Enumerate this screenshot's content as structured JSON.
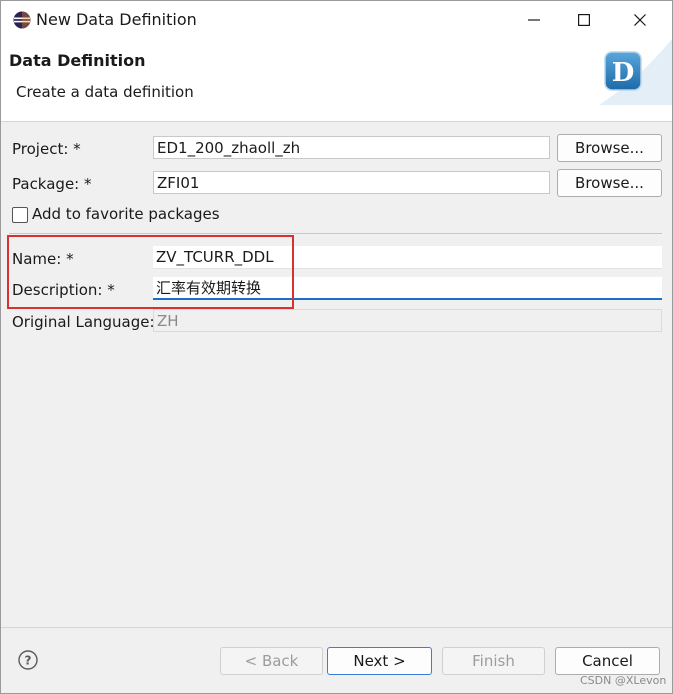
{
  "window": {
    "title": "New Data Definition"
  },
  "banner": {
    "title": "Data Definition",
    "subtitle": "Create a data definition",
    "icon_letter": "D"
  },
  "form": {
    "project": {
      "label": "Project: *",
      "value": "ED1_200_zhaoll_zh",
      "browse_label": "Browse..."
    },
    "package": {
      "label": "Package: *",
      "value": "ZFI01",
      "browse_label": "Browse..."
    },
    "favorite": {
      "label": "Add to favorite packages",
      "checked": false
    },
    "name": {
      "label": "Name: *",
      "value": "ZV_TCURR_DDL"
    },
    "description": {
      "label": "Description: *",
      "value": "汇率有效期转换"
    },
    "original_language": {
      "label": "Original Language:",
      "value": "ZH"
    }
  },
  "footer": {
    "back_label": "< Back",
    "next_label": "Next >",
    "finish_label": "Finish",
    "cancel_label": "Cancel",
    "watermark": "CSDN @XLevon"
  },
  "colors": {
    "focus_border": "#1d6fc7",
    "highlight_box": "#d93030",
    "default_button_border": "#3b7dd8"
  }
}
